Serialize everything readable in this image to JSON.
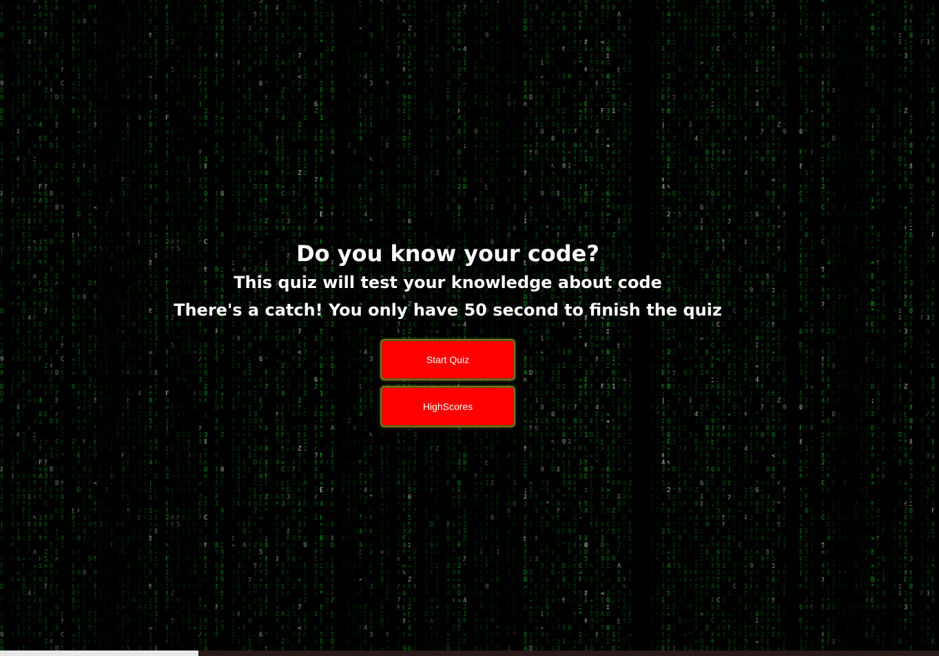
{
  "hero": {
    "title": "Do you know your code?",
    "subtitle_line1": "This quiz will test your knowledge about code",
    "subtitle_line2": "There's a catch! You only have 50 second to finish the quiz"
  },
  "buttons": {
    "start_label": "Start Quiz",
    "highscores_label": "HighScores"
  },
  "colors": {
    "background": "#000000",
    "matrix_green": "#33ff55",
    "button_bg": "#ff0000",
    "text": "#ffffff"
  }
}
